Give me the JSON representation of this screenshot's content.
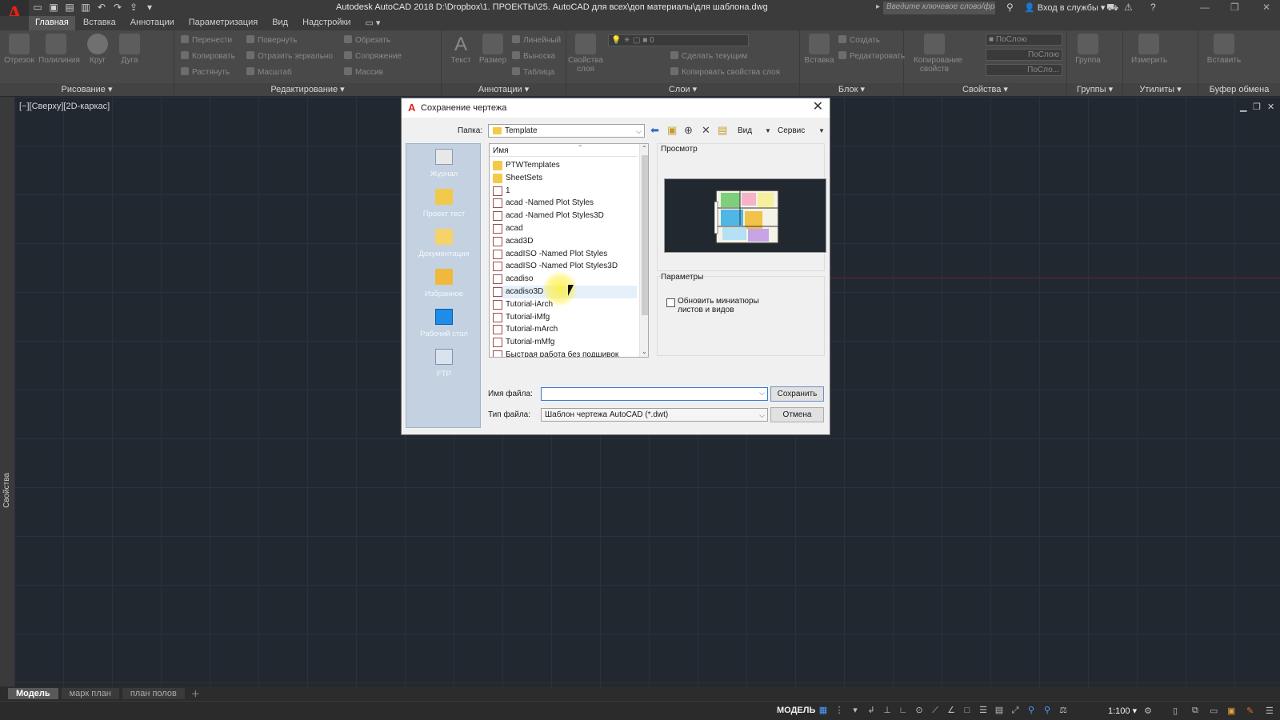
{
  "app": {
    "window_title": "Autodesk AutoCAD 2018    D:\\Dropbox\\1. ПРОЕКТЫ\\25. AutoCAD для всех\\доп материалы\\для шаблона.dwg",
    "search_placeholder": "Введите ключевое слово/фразу",
    "login_label": "Вход в службы",
    "accent_color": "#e2231a"
  },
  "ribbon": {
    "tabs": [
      "Главная",
      "Вставка",
      "Аннотации",
      "Параметризация",
      "Вид",
      "Надстройки"
    ],
    "active_tab": "Главная",
    "panels": {
      "draw": {
        "title": "Рисование",
        "items": [
          "Отрезок",
          "Полилиния",
          "Круг",
          "Дуга"
        ]
      },
      "modify": {
        "title": "Редактирование",
        "items": [
          "Перенести",
          "Повернуть",
          "Обрезать",
          "Копировать",
          "Отразить зеркально",
          "Сопряжение",
          "Растянуть",
          "Масштаб",
          "Массив"
        ]
      },
      "annotation": {
        "title": "Аннотации",
        "items": [
          "Текст",
          "Размер",
          "Линейный",
          "Выноска",
          "Таблица"
        ]
      },
      "layers": {
        "title": "Слои",
        "items": [
          "Свойства слоя",
          "Сделать текущим",
          "Копировать свойства слоя"
        ],
        "layer_value": "0"
      },
      "block": {
        "title": "Блок",
        "items": [
          "Вставка",
          "Создать",
          "Редактировать"
        ]
      },
      "properties": {
        "title": "Свойства",
        "items": [
          "Копирование свойств"
        ],
        "combo1": "ПоСлою",
        "combo2": "ПоСлою",
        "combo3": "ПоСло..."
      },
      "groups": {
        "title": "Группы",
        "items": [
          "Группа"
        ]
      },
      "utilities": {
        "title": "Утилиты",
        "items": [
          "Измерить"
        ]
      },
      "clipboard": {
        "title": "Буфер обмена",
        "items": [
          "Вставить"
        ]
      }
    }
  },
  "viewport": {
    "label": "[−][Сверху][2D-каркас]",
    "side_palette_label": "Свойства"
  },
  "layout_tabs": [
    "Модель",
    "марк план",
    "план полов"
  ],
  "statusbar": {
    "model_label": "МОДЕЛЬ",
    "scale": "1:100"
  },
  "dialog": {
    "title": "Сохранение чертежа",
    "folder_label": "Папка:",
    "folder_value": "Template",
    "view_menu": "Вид",
    "service_menu": "Сервис",
    "places": [
      {
        "label": "Журнал",
        "icon": "history-icon"
      },
      {
        "label": "Проект тест",
        "icon": "folder-icon"
      },
      {
        "label": "Документация",
        "icon": "documents-icon"
      },
      {
        "label": "Избранное",
        "icon": "favorites-icon"
      },
      {
        "label": "Рабочий стол",
        "icon": "desktop-icon"
      },
      {
        "label": "FTP",
        "icon": "ftp-icon"
      }
    ],
    "list_header": "Имя",
    "files": [
      {
        "name": "PTWTemplates",
        "type": "folder"
      },
      {
        "name": "SheetSets",
        "type": "folder"
      },
      {
        "name": "1",
        "type": "dwt"
      },
      {
        "name": "acad -Named Plot Styles",
        "type": "dwt"
      },
      {
        "name": "acad -Named Plot Styles3D",
        "type": "dwt"
      },
      {
        "name": "acad",
        "type": "dwt"
      },
      {
        "name": "acad3D",
        "type": "dwt"
      },
      {
        "name": "acadISO -Named Plot Styles",
        "type": "dwt"
      },
      {
        "name": "acadISO -Named Plot Styles3D",
        "type": "dwt"
      },
      {
        "name": "acadiso",
        "type": "dwt"
      },
      {
        "name": "acadiso3D",
        "type": "dwt",
        "highlighted": true
      },
      {
        "name": "Tutorial-iArch",
        "type": "dwt"
      },
      {
        "name": "Tutorial-iMfg",
        "type": "dwt"
      },
      {
        "name": "Tutorial-mArch",
        "type": "dwt"
      },
      {
        "name": "Tutorial-mMfg",
        "type": "dwt"
      },
      {
        "name": "Быстрая работа без подшивок",
        "type": "dwt"
      }
    ],
    "preview_label": "Просмотр",
    "params_label": "Параметры",
    "update_thumbs_label": "Обновить миниатюры листов и видов",
    "filename_label": "Имя файла:",
    "filename_value": "",
    "filetype_label": "Тип файла:",
    "filetype_value": "Шаблон чертежа AutoCAD (*.dwt)",
    "save_button": "Сохранить",
    "cancel_button": "Отмена"
  }
}
